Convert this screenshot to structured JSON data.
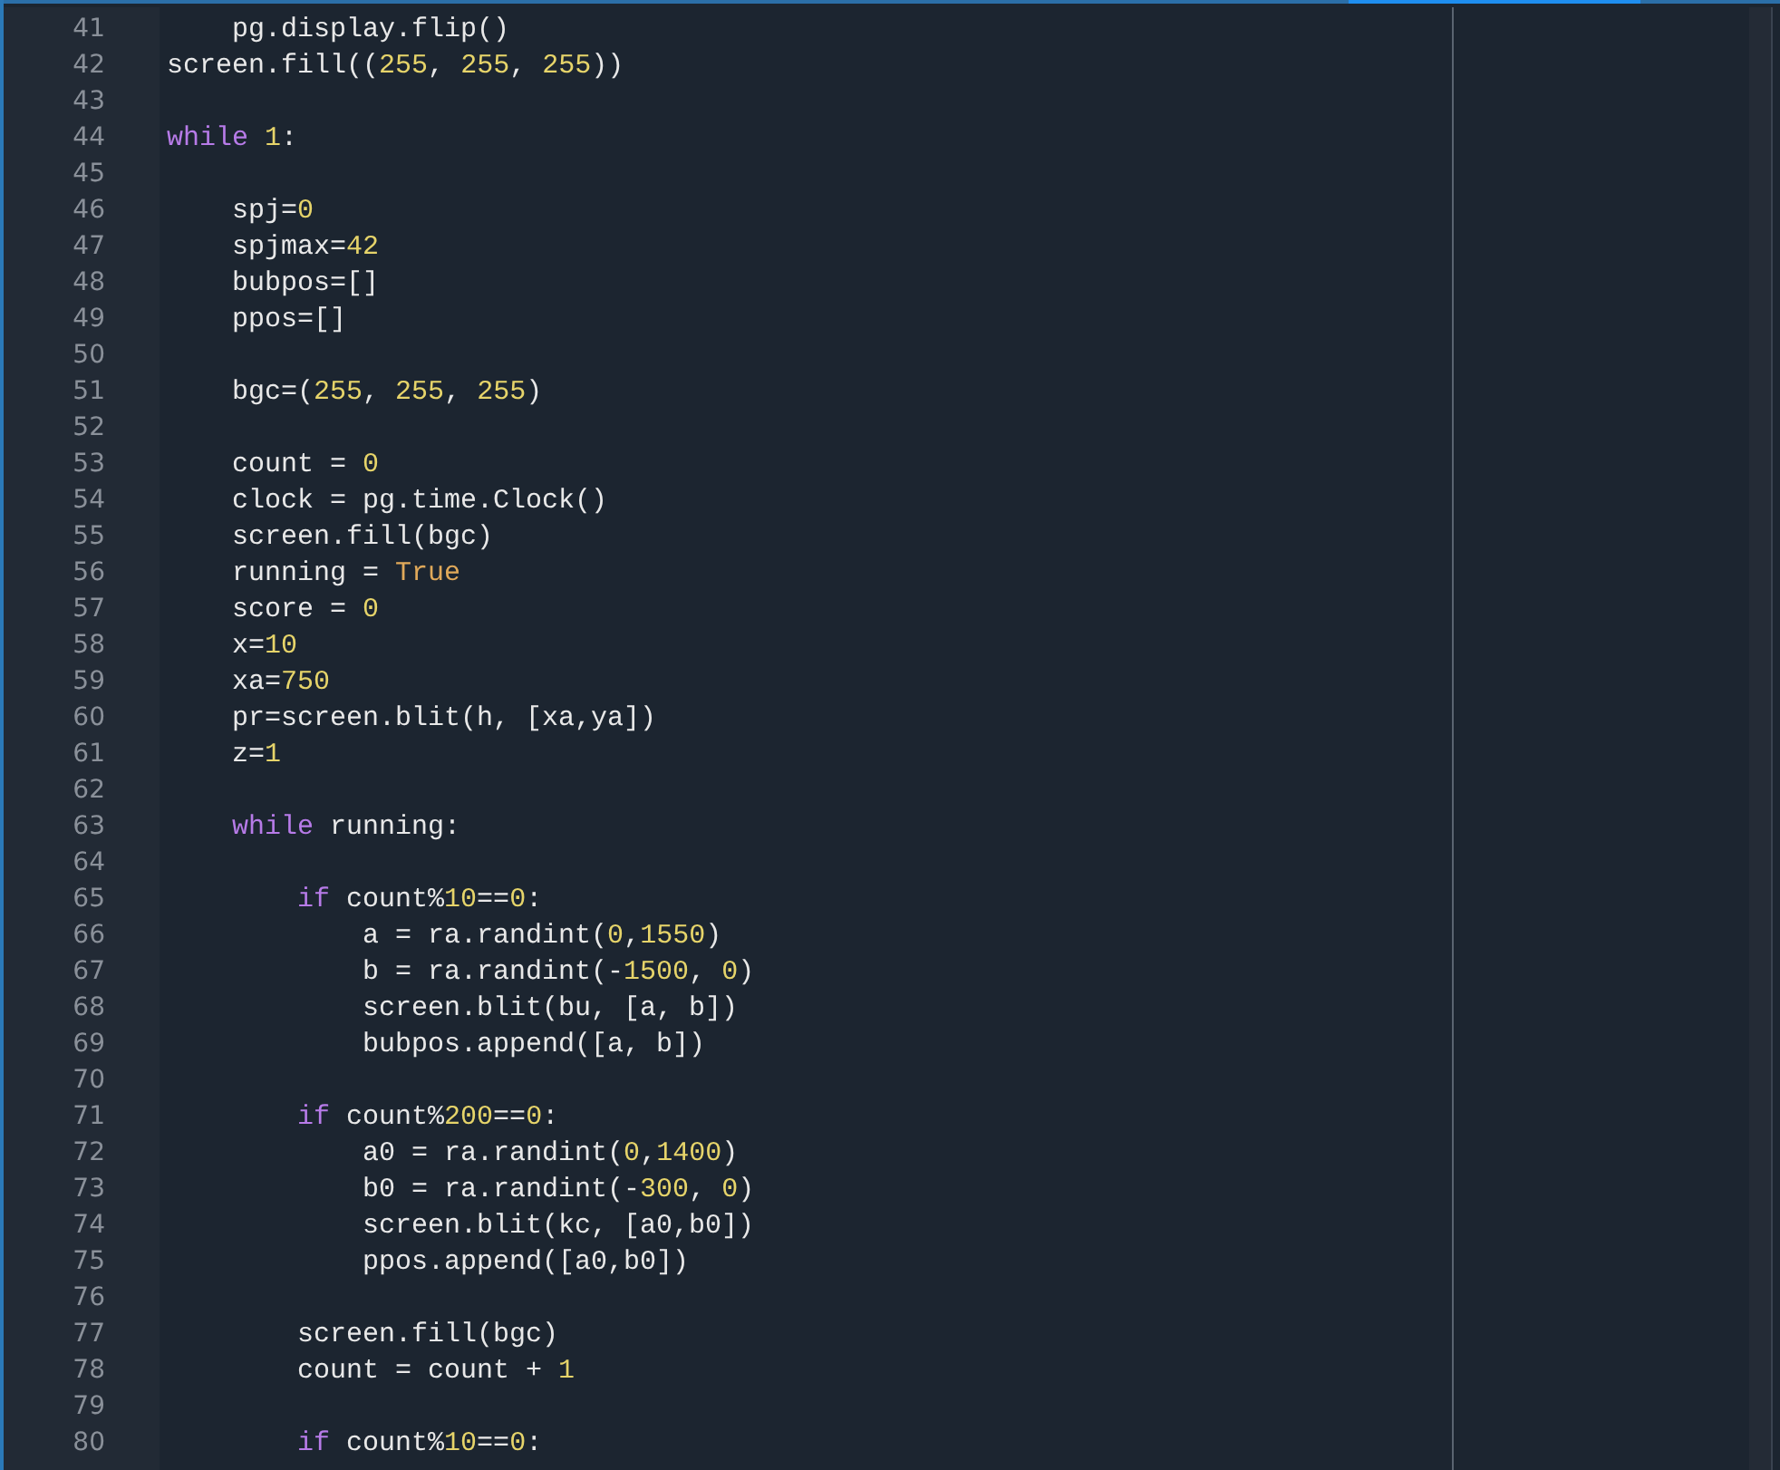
{
  "editor": {
    "lines": [
      {
        "number": "41",
        "tokens": [
          {
            "kind": "plain",
            "text": "    pg.display.flip()"
          }
        ]
      },
      {
        "number": "42",
        "tokens": [
          {
            "kind": "plain",
            "text": "screen.fill(("
          },
          {
            "kind": "number",
            "text": "255"
          },
          {
            "kind": "plain",
            "text": ", "
          },
          {
            "kind": "number",
            "text": "255"
          },
          {
            "kind": "plain",
            "text": ", "
          },
          {
            "kind": "number",
            "text": "255"
          },
          {
            "kind": "plain",
            "text": "))"
          }
        ]
      },
      {
        "number": "43"
      },
      {
        "number": "44",
        "tokens": [
          {
            "kind": "keyword",
            "text": "while "
          },
          {
            "kind": "number",
            "text": "1"
          },
          {
            "kind": "plain",
            "text": ":"
          }
        ]
      },
      {
        "number": "45"
      },
      {
        "number": "46",
        "tokens": [
          {
            "kind": "plain",
            "text": "    spj="
          },
          {
            "kind": "number",
            "text": "0"
          }
        ]
      },
      {
        "number": "47",
        "tokens": [
          {
            "kind": "plain",
            "text": "    spjmax="
          },
          {
            "kind": "number",
            "text": "42"
          }
        ]
      },
      {
        "number": "48",
        "tokens": [
          {
            "kind": "plain",
            "text": "    bubpos=[]"
          }
        ]
      },
      {
        "number": "49",
        "tokens": [
          {
            "kind": "plain",
            "text": "    ppos=[]"
          }
        ]
      },
      {
        "number": "50"
      },
      {
        "number": "51",
        "tokens": [
          {
            "kind": "plain",
            "text": "    bgc=("
          },
          {
            "kind": "number",
            "text": "255"
          },
          {
            "kind": "plain",
            "text": ", "
          },
          {
            "kind": "number",
            "text": "255"
          },
          {
            "kind": "plain",
            "text": ", "
          },
          {
            "kind": "number",
            "text": "255"
          },
          {
            "kind": "plain",
            "text": ")"
          }
        ]
      },
      {
        "number": "52"
      },
      {
        "number": "53",
        "tokens": [
          {
            "kind": "plain",
            "text": "    count = "
          },
          {
            "kind": "number",
            "text": "0"
          }
        ]
      },
      {
        "number": "54",
        "tokens": [
          {
            "kind": "plain",
            "text": "    clock = pg.time.Clock()"
          }
        ]
      },
      {
        "number": "55",
        "tokens": [
          {
            "kind": "plain",
            "text": "    screen.fill(bgc)"
          }
        ]
      },
      {
        "number": "56",
        "tokens": [
          {
            "kind": "plain",
            "text": "    running = "
          },
          {
            "kind": "constant",
            "text": "True"
          }
        ]
      },
      {
        "number": "57",
        "tokens": [
          {
            "kind": "plain",
            "text": "    score = "
          },
          {
            "kind": "number",
            "text": "0"
          }
        ]
      },
      {
        "number": "58",
        "tokens": [
          {
            "kind": "plain",
            "text": "    x="
          },
          {
            "kind": "number",
            "text": "10"
          }
        ]
      },
      {
        "number": "59",
        "tokens": [
          {
            "kind": "plain",
            "text": "    xa="
          },
          {
            "kind": "number",
            "text": "750"
          }
        ]
      },
      {
        "number": "60",
        "tokens": [
          {
            "kind": "plain",
            "text": "    pr=screen.blit(h, [xa,ya])"
          }
        ]
      },
      {
        "number": "61",
        "tokens": [
          {
            "kind": "plain",
            "text": "    z="
          },
          {
            "kind": "number",
            "text": "1"
          }
        ]
      },
      {
        "number": "62"
      },
      {
        "number": "63",
        "tokens": [
          {
            "kind": "keyword",
            "text": "    while"
          },
          {
            "kind": "plain",
            "text": " running:"
          }
        ]
      },
      {
        "number": "64"
      },
      {
        "number": "65",
        "tokens": [
          {
            "kind": "keyword",
            "text": "        if"
          },
          {
            "kind": "plain",
            "text": " count%"
          },
          {
            "kind": "number",
            "text": "10"
          },
          {
            "kind": "plain",
            "text": "=="
          },
          {
            "kind": "number",
            "text": "0"
          },
          {
            "kind": "plain",
            "text": ":"
          }
        ]
      },
      {
        "number": "66",
        "tokens": [
          {
            "kind": "plain",
            "text": "            a = ra.randint("
          },
          {
            "kind": "number",
            "text": "0"
          },
          {
            "kind": "plain",
            "text": ","
          },
          {
            "kind": "number",
            "text": "1550"
          },
          {
            "kind": "plain",
            "text": ")"
          }
        ]
      },
      {
        "number": "67",
        "tokens": [
          {
            "kind": "plain",
            "text": "            b = ra.randint(-"
          },
          {
            "kind": "number",
            "text": "1500"
          },
          {
            "kind": "plain",
            "text": ", "
          },
          {
            "kind": "number",
            "text": "0"
          },
          {
            "kind": "plain",
            "text": ")"
          }
        ]
      },
      {
        "number": "68",
        "tokens": [
          {
            "kind": "plain",
            "text": "            screen.blit(bu, [a, b])"
          }
        ]
      },
      {
        "number": "69",
        "tokens": [
          {
            "kind": "plain",
            "text": "            bubpos.append([a, b])"
          }
        ]
      },
      {
        "number": "70"
      },
      {
        "number": "71",
        "tokens": [
          {
            "kind": "keyword",
            "text": "        if"
          },
          {
            "kind": "plain",
            "text": " count%"
          },
          {
            "kind": "number",
            "text": "200"
          },
          {
            "kind": "plain",
            "text": "=="
          },
          {
            "kind": "number",
            "text": "0"
          },
          {
            "kind": "plain",
            "text": ":"
          }
        ]
      },
      {
        "number": "72",
        "tokens": [
          {
            "kind": "plain",
            "text": "            a0 = ra.randint("
          },
          {
            "kind": "number",
            "text": "0"
          },
          {
            "kind": "plain",
            "text": ","
          },
          {
            "kind": "number",
            "text": "1400"
          },
          {
            "kind": "plain",
            "text": ")"
          }
        ]
      },
      {
        "number": "73",
        "tokens": [
          {
            "kind": "plain",
            "text": "            b0 = ra.randint(-"
          },
          {
            "kind": "number",
            "text": "300"
          },
          {
            "kind": "plain",
            "text": ", "
          },
          {
            "kind": "number",
            "text": "0"
          },
          {
            "kind": "plain",
            "text": ")"
          }
        ]
      },
      {
        "number": "74",
        "tokens": [
          {
            "kind": "plain",
            "text": "            screen.blit(kc, [a0,b0])"
          }
        ]
      },
      {
        "number": "75",
        "tokens": [
          {
            "kind": "plain",
            "text": "            ppos.append([a0,b0])"
          }
        ]
      },
      {
        "number": "76"
      },
      {
        "number": "77",
        "tokens": [
          {
            "kind": "plain",
            "text": "        screen.fill(bgc)"
          }
        ]
      },
      {
        "number": "78",
        "tokens": [
          {
            "kind": "plain",
            "text": "        count = count + "
          },
          {
            "kind": "number",
            "text": "1"
          }
        ]
      },
      {
        "number": "79"
      },
      {
        "number": "80",
        "tokens": [
          {
            "kind": "keyword",
            "text": "        if"
          },
          {
            "kind": "plain",
            "text": " count%"
          },
          {
            "kind": "number",
            "text": "10"
          },
          {
            "kind": "plain",
            "text": "=="
          },
          {
            "kind": "number",
            "text": "0"
          },
          {
            "kind": "plain",
            "text": ":"
          }
        ]
      }
    ]
  }
}
